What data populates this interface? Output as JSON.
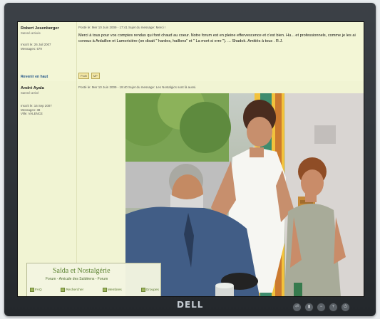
{
  "post1": {
    "author": "Robert Jesenberger",
    "rank": "Saïené arrivée",
    "info": [
      "Inscrit le: 26 Juil 2007",
      "Messages: 579"
    ],
    "meta": "Posté le: Mer 10 Juin 2009 - 17:41    Sujet du message: Merci !",
    "text": "Merci à tous pour vos comptes rendus qui font chaud au coeur. Notre forum est en pleine effervescence et c'est bien. Hu... et professionnels, comme je les ai connus à Ardaillon et Lamoricière (on disait \" hardes, haillons\" et \" La mort si erre \"). ... Shadok. Amitiés à tous . R.J.",
    "buttons": [
      "Profil",
      "MP"
    ],
    "back_to_top": "Revenir en haut"
  },
  "post2": {
    "author": "André Ayala",
    "rank": "Saïené arrivé",
    "info": [
      "Inscrit le: 16 Sep 2007",
      "Messages: 38",
      "Ville: VALENCE"
    ],
    "meta": "Posté le: Mer 10 Juin 2009 - 19:40    Sujet du message: Les Nostalgics sont là aussi."
  },
  "forum": {
    "title": "Saïda et Nostalgérie",
    "subtitle": "Forum - Amicale des Saïdéens - Forum",
    "nav": [
      {
        "label": "FAQ",
        "icon": "faq-icon"
      },
      {
        "label": "Rechercher",
        "icon": "search-icon"
      },
      {
        "label": "Membres",
        "icon": "members-icon"
      },
      {
        "label": "Groupes",
        "icon": "groups-icon"
      }
    ]
  },
  "monitor": {
    "brand": "DELL"
  }
}
